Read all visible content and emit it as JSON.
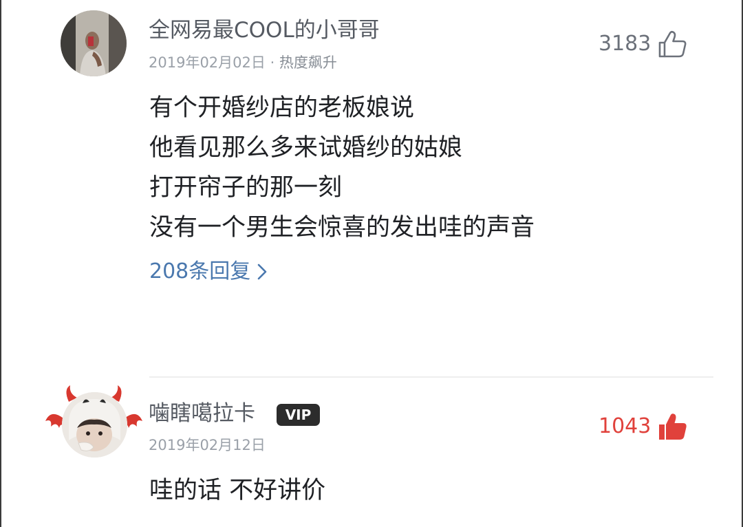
{
  "comments": [
    {
      "username": "全网易最COOL的小哥哥",
      "date": "2019年02月02日",
      "tag": "热度飙升",
      "separator": " · ",
      "likes": "3183",
      "liked": false,
      "lines": [
        "有个开婚纱店的老板娘说",
        "他看见那么多来试婚纱的姑娘",
        "打开帘子的那一刻",
        "没有一个男生会惊喜的发出哇的声音"
      ],
      "replies_label": "208条回复",
      "replies_chevron": "›"
    },
    {
      "username": "噛瞎噶拉卡",
      "badge": "VIP",
      "date": "2019年02月12日",
      "likes": "1043",
      "liked": true,
      "lines": [
        "哇的话 不好讲价"
      ]
    }
  ],
  "colors": {
    "username": "#555a62",
    "meta": "#9aa0a8",
    "body": "#1f2125",
    "replies_link": "#4a78ae",
    "like_inactive": "#6c717a",
    "like_active": "#e0413b",
    "vip_badge_bg": "#2c2c2c"
  },
  "icons": {
    "like_outline": "thumbs-up-outline-icon",
    "like_filled": "thumbs-up-filled-icon",
    "chevron": "chevron-right-icon"
  }
}
